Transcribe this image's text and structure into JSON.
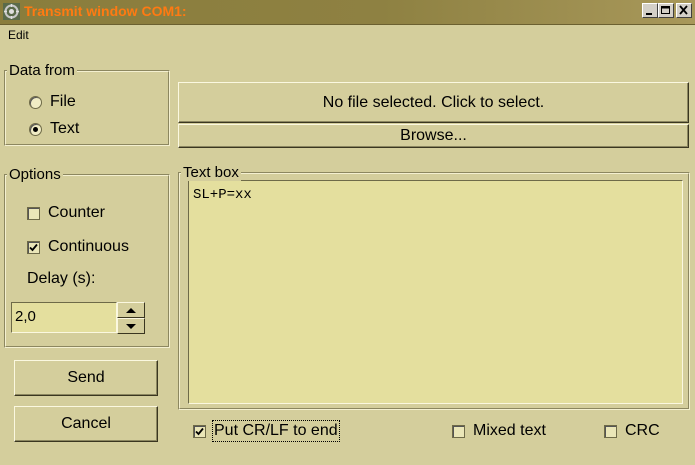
{
  "window": {
    "title": "Transmit window COM1:"
  },
  "menu": {
    "edit": "Edit"
  },
  "data_from": {
    "label": "Data from",
    "options": [
      {
        "label": "File",
        "selected": false
      },
      {
        "label": "Text",
        "selected": true
      }
    ]
  },
  "file": {
    "status": "No file selected. Click to select.",
    "browse_label": "Browse..."
  },
  "options": {
    "label": "Options",
    "counter_label": "Counter",
    "counter_checked": false,
    "continuous_label": "Continuous",
    "continuous_checked": true,
    "delay_label": "Delay (s):",
    "delay_value": "2,0"
  },
  "actions": {
    "send_label": "Send",
    "cancel_label": "Cancel"
  },
  "text_box": {
    "label": "Text box",
    "content": "SL+P=xx"
  },
  "bottom": {
    "crlf_label": "Put CR/LF to end",
    "crlf_checked": true,
    "mixed_label": "Mixed text",
    "mixed_checked": false,
    "crc_label": "CRC",
    "crc_checked": false
  },
  "colors": {
    "title_text": "#ff7a12",
    "face": "#d4ce9c",
    "field": "#e4df9e"
  }
}
